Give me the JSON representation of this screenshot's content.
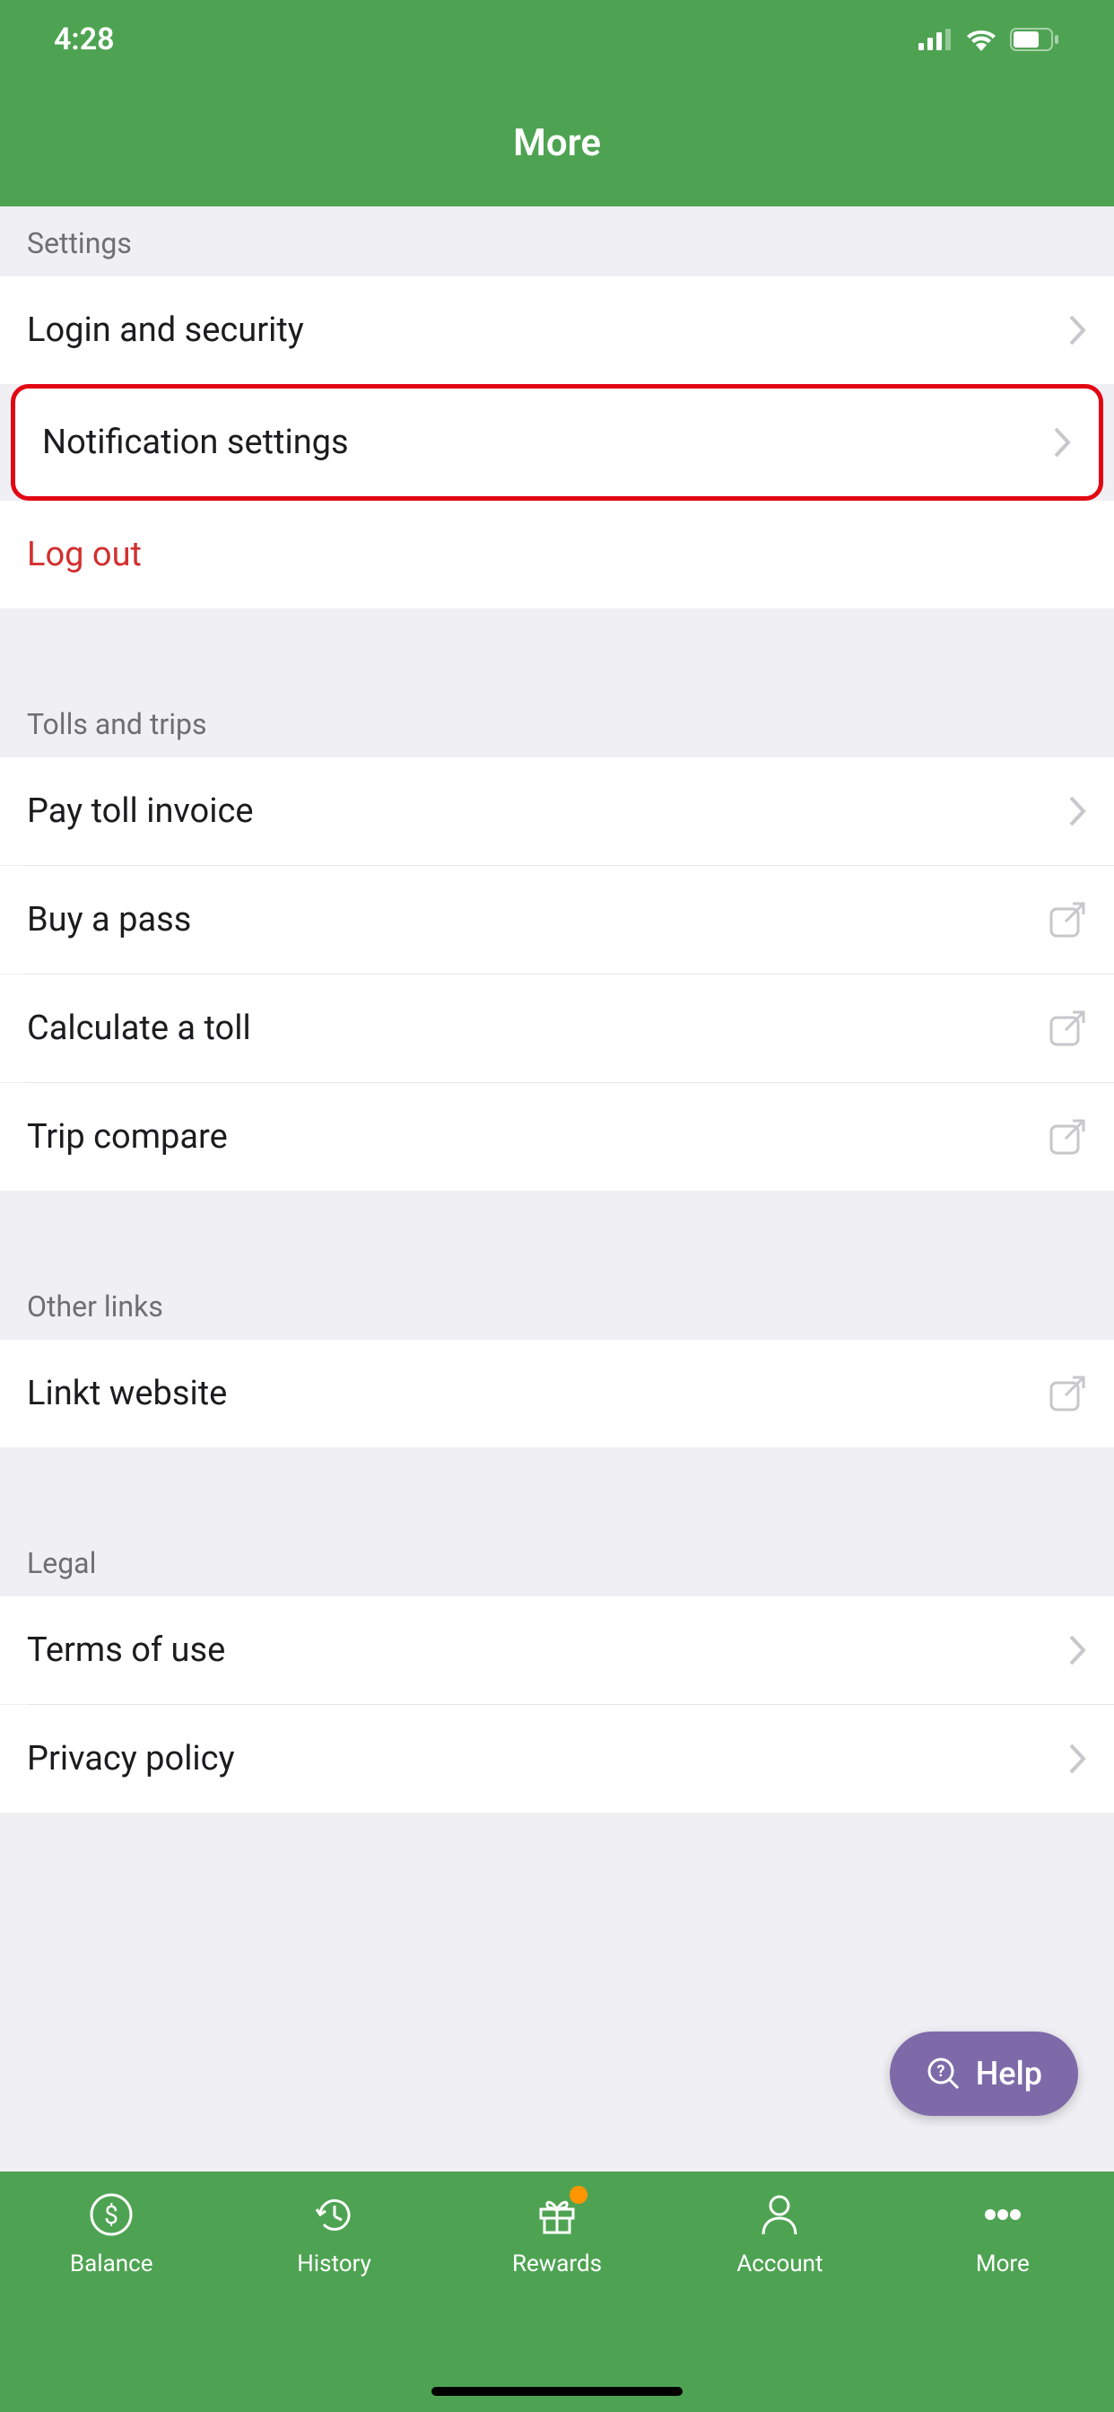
{
  "statusBar": {
    "time": "4:28"
  },
  "navBar": {
    "title": "More"
  },
  "sections": {
    "settings": {
      "header": "Settings",
      "items": {
        "loginSecurity": "Login and security",
        "notificationSettings": "Notification settings",
        "logOut": "Log out"
      }
    },
    "tollsTrips": {
      "header": "Tolls and trips",
      "items": {
        "payTollInvoice": "Pay toll invoice",
        "buyPass": "Buy a pass",
        "calculateToll": "Calculate a toll",
        "tripCompare": "Trip compare"
      }
    },
    "otherLinks": {
      "header": "Other links",
      "items": {
        "linktWebsite": "Linkt website"
      }
    },
    "legal": {
      "header": "Legal",
      "items": {
        "termsOfUse": "Terms of use",
        "privacyPolicy": "Privacy policy"
      }
    }
  },
  "helpButton": {
    "label": "Help"
  },
  "tabBar": {
    "balance": "Balance",
    "history": "History",
    "rewards": "Rewards",
    "account": "Account",
    "more": "More"
  }
}
